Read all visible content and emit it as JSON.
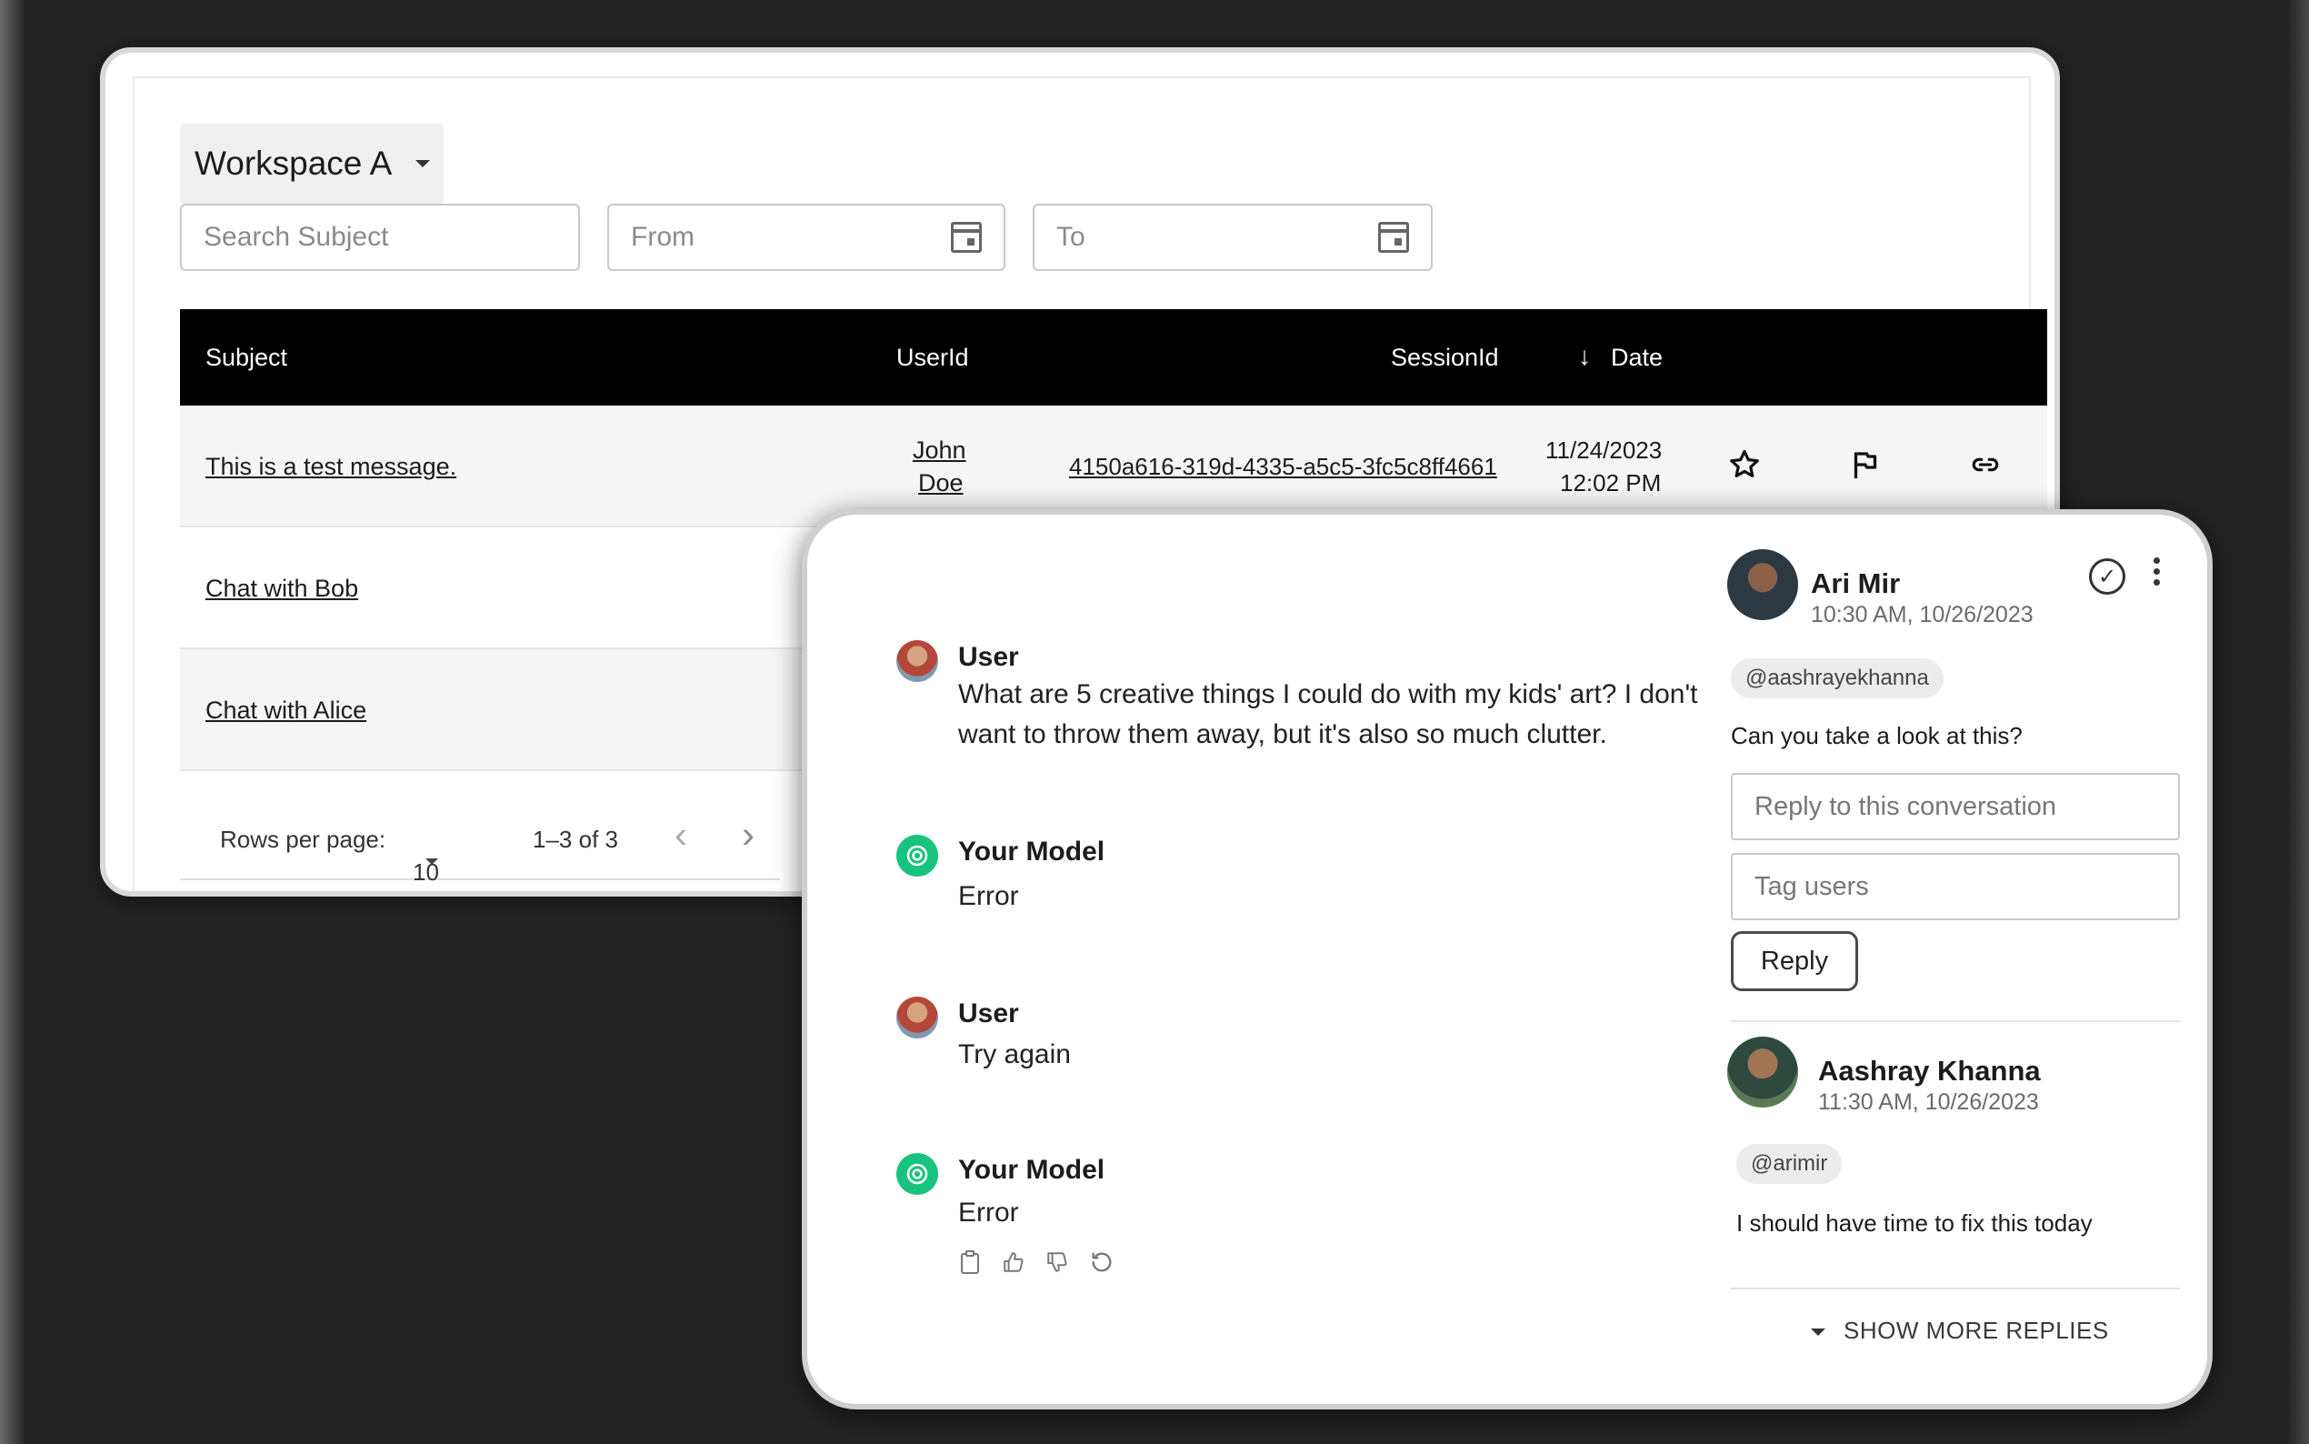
{
  "workspace": {
    "label": "Workspace A"
  },
  "filters": {
    "search_placeholder": "Search Subject",
    "from_placeholder": "From",
    "to_placeholder": "To"
  },
  "table": {
    "headers": {
      "subject": "Subject",
      "userid": "UserId",
      "sessionid": "SessionId",
      "date": "Date",
      "sort_arrow": "↓"
    },
    "rows": [
      {
        "subject": "This is a test message.",
        "user_line1": "John",
        "user_line2": "Doe",
        "session": "4150a616-319d-4335-a5c5-3fc5c8ff4661",
        "date_line1": "11/24/2023",
        "date_line2": "12:02 PM"
      },
      {
        "subject": "Chat with Bob"
      },
      {
        "subject": "Chat with Alice"
      }
    ]
  },
  "pagination": {
    "rows_label": "Rows per page:",
    "rows_value": "10",
    "range": "1–3 of 3",
    "prev": "‹",
    "next": "›"
  },
  "conversation": {
    "messages": [
      {
        "author": "User",
        "text_line1": "What are 5 creative things I could do with my kids' art? I don't",
        "text_line2": "want to throw them away, but it's also so much clutter."
      },
      {
        "author": "Your Model",
        "text": "Error"
      },
      {
        "author": "User",
        "text": "Try again"
      },
      {
        "author": "Your Model",
        "text": "Error"
      }
    ],
    "tool_icons": {
      "copy": "📋",
      "thumbs_up": "👍",
      "thumbs_down": "👎",
      "regenerate": "↻"
    }
  },
  "comments": {
    "first": {
      "name": "Ari Mir",
      "time": "10:30 AM, 10/26/2023",
      "mention": "@aashrayekhanna",
      "text": "Can you take a look at this?"
    },
    "reply_placeholder": "Reply to this conversation",
    "tag_placeholder": "Tag users",
    "reply_label": "Reply",
    "second": {
      "name": "Aashray Khanna",
      "time": "11:30 AM, 10/26/2023",
      "mention": "@arimir",
      "text": "I should have time to fix this today"
    },
    "show_more": "SHOW MORE REPLIES",
    "check_glyph": "✓"
  }
}
